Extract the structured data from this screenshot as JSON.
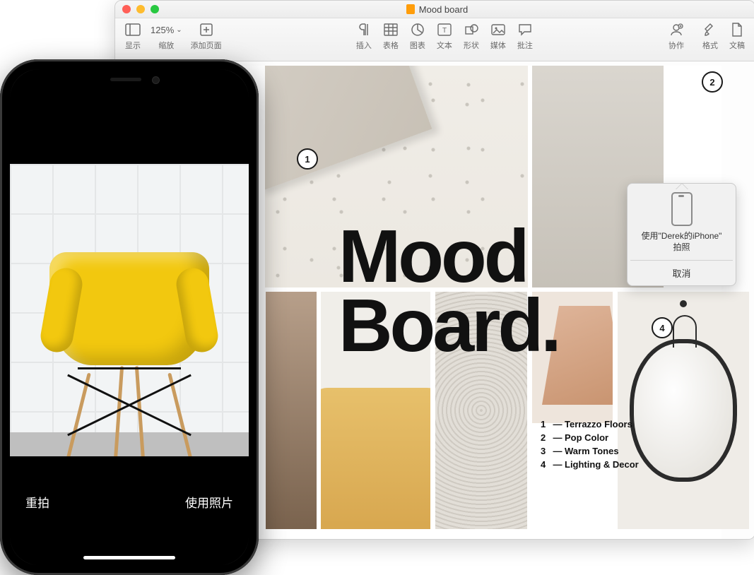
{
  "window": {
    "title": "Mood board",
    "traffic": {
      "close": "close",
      "min": "minimize",
      "max": "maximize"
    }
  },
  "toolbar": {
    "view": "显示",
    "zoom_label": "缩放",
    "zoom_value": "125%",
    "add_page": "添加页面",
    "insert": "插入",
    "table": "表格",
    "chart": "图表",
    "text": "文本",
    "shape": "形状",
    "media": "媒体",
    "comment": "批注",
    "collab": "协作",
    "format": "格式",
    "document": "文稿"
  },
  "document": {
    "headline_1": "Mood",
    "headline_2": "Board.",
    "callouts": {
      "c1": "1",
      "c2": "2",
      "c4": "4"
    },
    "legend": [
      {
        "n": "1",
        "t": "Terrazzo Floors"
      },
      {
        "n": "2",
        "t": "Pop Color"
      },
      {
        "n": "3",
        "t": "Warm Tones"
      },
      {
        "n": "4",
        "t": "Lighting & Decor"
      }
    ]
  },
  "popover": {
    "line1": "使用\"Derek的iPhone\"",
    "line2": "拍照",
    "cancel": "取消"
  },
  "iphone": {
    "retake": "重拍",
    "use_photo": "使用照片"
  }
}
